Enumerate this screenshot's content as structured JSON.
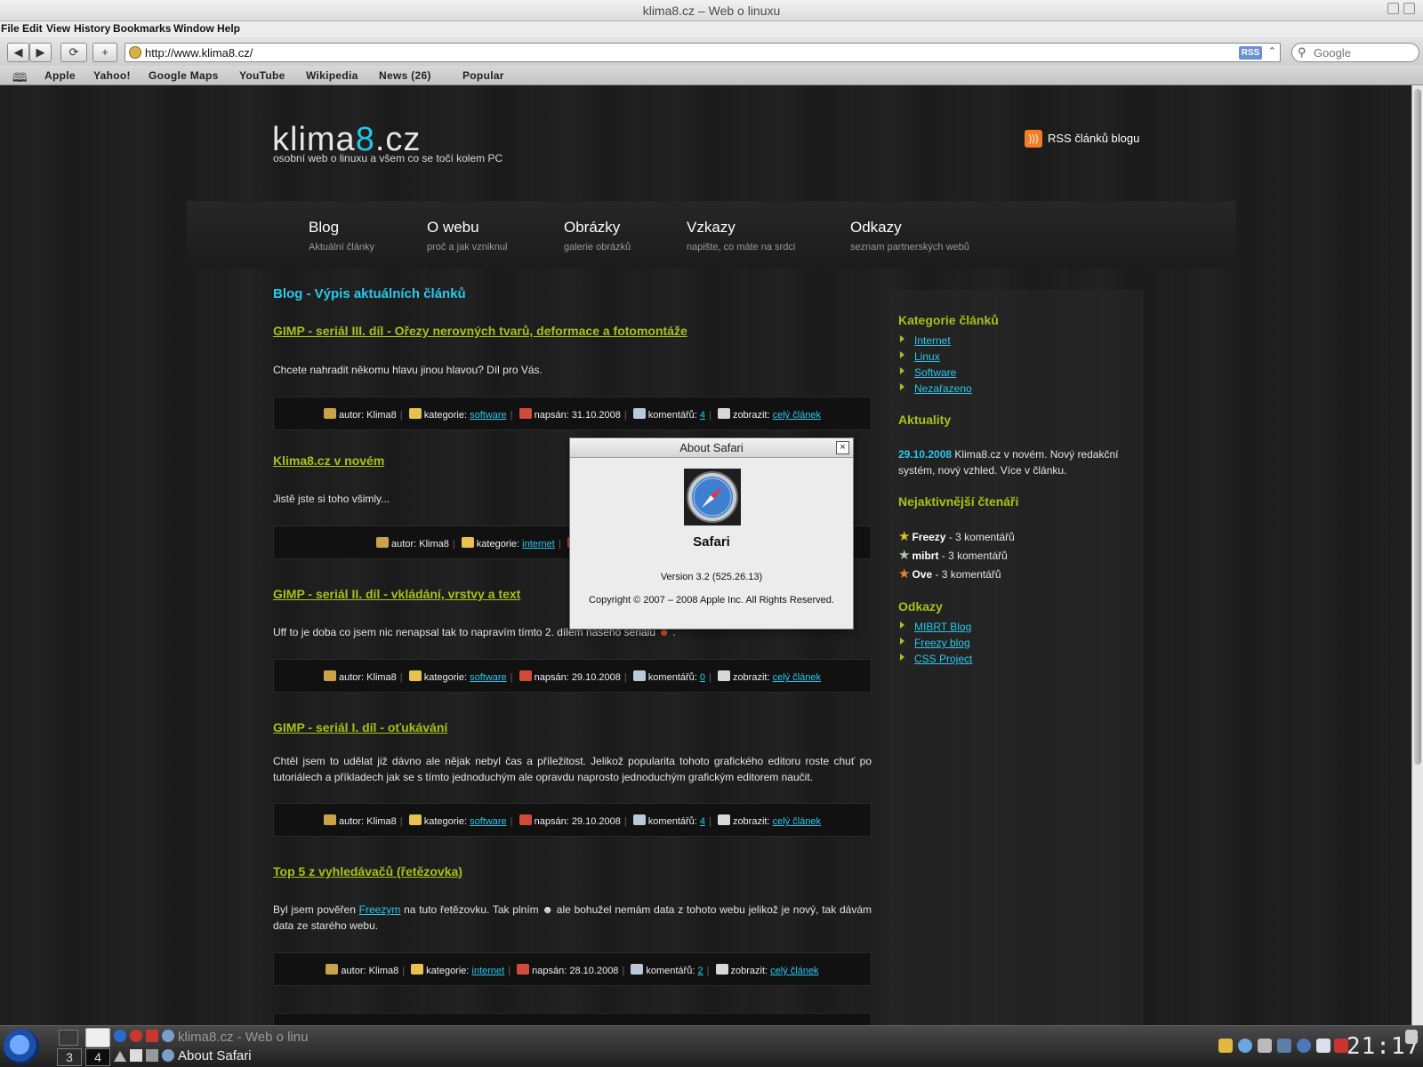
{
  "window": {
    "title": "klima8.cz – Web o linuxu"
  },
  "menu": [
    "File",
    "Edit",
    "View",
    "History",
    "Bookmarks",
    "Window",
    "Help"
  ],
  "toolbar": {
    "back": "◀",
    "forward": "▶",
    "reload": "⟳",
    "add": "+",
    "url": "http://www.klima8.cz/",
    "rss": "RSS",
    "search_placeholder": "Google"
  },
  "bookmarks": [
    "Apple",
    "Yahoo!",
    "Google Maps",
    "YouTube",
    "Wikipedia",
    "News (26)",
    "Popular"
  ],
  "site": {
    "logo_pre": "klima",
    "logo_num": "8",
    "logo_post": ".cz",
    "tagline": "osobní web o linuxu a všem co se točí kolem PC",
    "rss": "RSS článků blogu"
  },
  "nav": [
    {
      "title": "Blog",
      "sub": "Aktuální články"
    },
    {
      "title": "O webu",
      "sub": "proč a jak vzniknul"
    },
    {
      "title": "Obrázky",
      "sub": "galerie obrázků"
    },
    {
      "title": "Vzkazy",
      "sub": "napište, co máte na srdci"
    },
    {
      "title": "Odkazy",
      "sub": "seznam partnerských webů"
    }
  ],
  "main_title": "Blog - Výpis aktuálních článků",
  "meta_labels": {
    "author": "autor: Klima8",
    "category": "kategorie:",
    "written": "napsán:",
    "comments": "komentářů:",
    "show": "zobrazit:",
    "full": "celý článek"
  },
  "articles": [
    {
      "title": "GIMP - seriál III. díl - Ořezy nerovných tvarů, deformace a fotomontáže",
      "text": "Chcete nahradit někomu hlavu jinou hlavou? Díl pro Vás.",
      "category": "software",
      "date": "31.10.2008",
      "comments": "4"
    },
    {
      "title": "Klima8.cz v novém",
      "text": "Jistě jste si toho všimly...",
      "category": "internet",
      "date": "",
      "comments": ""
    },
    {
      "title": "GIMP - seriál II. díl - vkládání, vrstvy a text",
      "text": "Uff to je doba co jsem nic nenapsal tak to napravím tímto 2. dílem našeho seriálu",
      "category": "software",
      "date": "29.10.2008",
      "comments": "0"
    },
    {
      "title": "GIMP - seriál I. díl - oťukávání",
      "text": "Chtěl jsem to udělat již dávno ale nějak nebyl čas a příležitost. Jelikož popularita tohoto grafického editoru roste chuť po tutoriálech a příkladech jak se s tímto jednoduchým ale opravdu naprosto jednoduchým grafickým editorem naučit.",
      "category": "software",
      "date": "29.10.2008",
      "comments": "4"
    },
    {
      "title": "Top 5 z vyhledávačů (řetězovka)",
      "text_pre": "Byl jsem pověřen ",
      "text_link": "Freezym",
      "text_post": " na tuto řetězovku. Tak plním ☻ ale bohužel nemám data z tohoto webu jelikož je nový, tak dávám data ze starého webu.",
      "category": "internet",
      "date": "28.10.2008",
      "comments": "2"
    }
  ],
  "sidebar": {
    "categories_title": "Kategorie článků",
    "categories": [
      "Internet",
      "Linux",
      "Software",
      "Nezařazeno"
    ],
    "news_title": "Aktuality",
    "news_date": "29.10.2008",
    "news_text": " Klima8.cz v novém. Nový redakční systém, nový vzhled. Více v článku.",
    "readers_title": "Nejaktivnější čtenáři",
    "readers": [
      {
        "name": "Freezy",
        "count": " - 3 komentářů"
      },
      {
        "name": "mibrt",
        "count": " - 3 komentářů"
      },
      {
        "name": "Ove",
        "count": " - 3 komentářů"
      }
    ],
    "links_title": "Odkazy",
    "links": [
      "MIBRT Blog",
      "Freezy blog",
      "CSS Project"
    ]
  },
  "dialog": {
    "title": "About Safari",
    "close": "×",
    "app": "Safari",
    "version": "Version 3.2 (525.26.13)",
    "copyright": "Copyright © 2007 – 2008 Apple Inc. All Rights Reserved."
  },
  "taskbar": {
    "desktops": [
      "3",
      "4"
    ],
    "task1": "klima8.cz - Web o linu",
    "task2": "About Safari",
    "clock": "21:17"
  }
}
